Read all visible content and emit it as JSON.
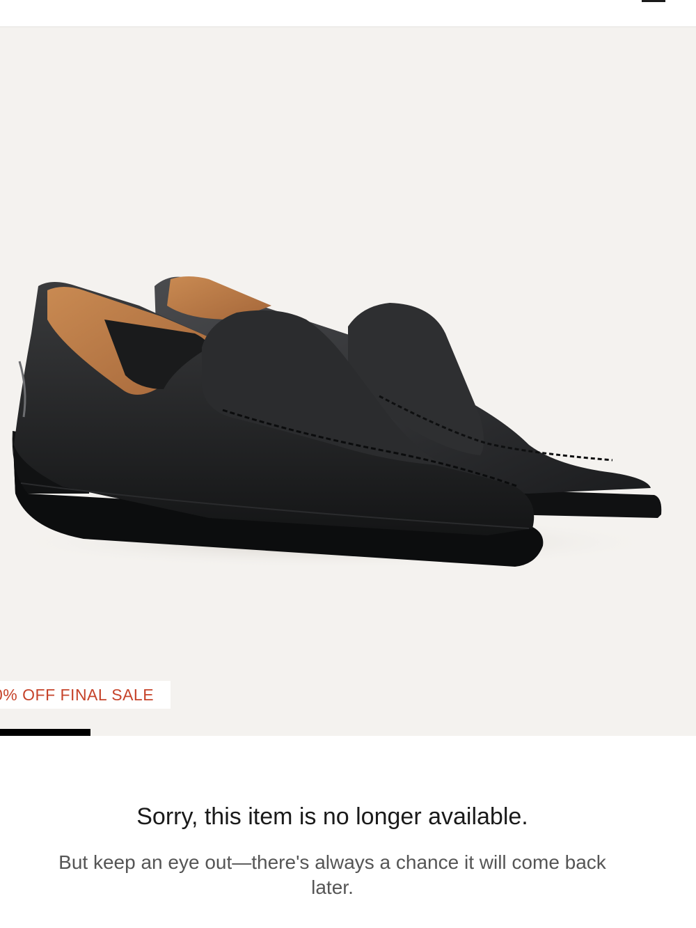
{
  "header": {
    "menu_icon": "hamburger-menu-icon"
  },
  "product": {
    "image_alt": "black-leather-loafers-pair",
    "badge_text": "0% OFF FINAL SALE",
    "badge_color": "#c6432a",
    "carousel_progress": 0.13
  },
  "availability": {
    "title": "Sorry, this item is no longer available.",
    "body": "But keep an eye out—there's always a chance it will come back later."
  }
}
